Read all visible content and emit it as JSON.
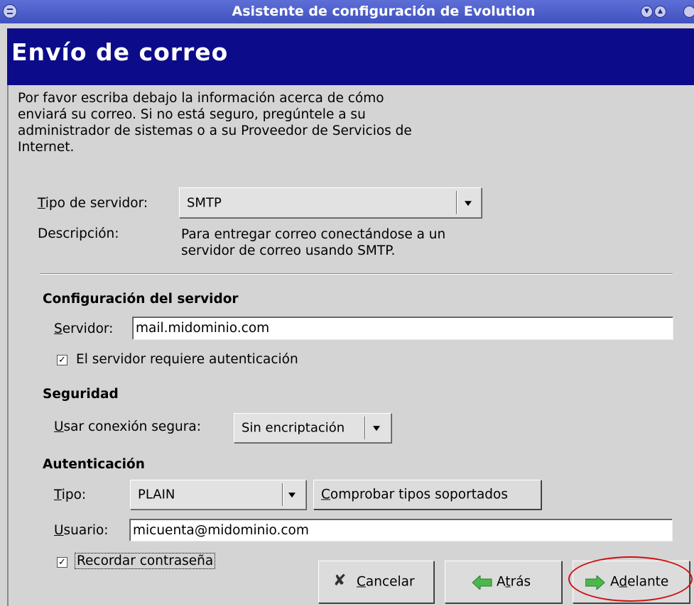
{
  "window": {
    "title": "Asistente de configuración de Evolution"
  },
  "header": {
    "title": "Envío de correo"
  },
  "intro": "Por favor escriba debajo la información acerca de cómo enviará su correo. Si no está seguro, pregúntele a su administrador de sistemas o a su Proveedor de Servicios de Internet.",
  "server_type": {
    "label": "Tipo de servidor:",
    "value": "SMTP",
    "description_label": "Descripción:",
    "description": "Para entregar correo conectándose a un servidor de correo usando SMTP."
  },
  "server_config": {
    "title": "Configuración del servidor",
    "server_label": "Servidor:",
    "server_value": "mail.midominio.com",
    "requires_auth_label": "El servidor requiere autenticación",
    "requires_auth_checked": true
  },
  "security": {
    "title": "Seguridad",
    "secure_label": "Usar conexión segura:",
    "secure_value": "Sin encriptación"
  },
  "auth": {
    "title": "Autenticación",
    "type_label": "Tipo:",
    "type_value": "PLAIN",
    "check_types_button": "Comprobar tipos soportados",
    "user_label": "Usuario:",
    "user_value": "micuenta@midominio.com",
    "remember_label": "Recordar contraseña",
    "remember_checked": true
  },
  "buttons": {
    "cancel": "Cancelar",
    "back": "Atrás",
    "forward": "Adelante"
  },
  "colors": {
    "title_bar": "#4a5bc8",
    "header_band": "#0c0c8a",
    "window_bg": "#d4d4d4",
    "highlight_circle": "#d01010",
    "arrow_icon": "#4cb84c"
  },
  "icons": [
    "window-menu-icon",
    "minimize-icon",
    "maximize-icon",
    "close-icon",
    "cancel-x-icon",
    "back-arrow-icon",
    "forward-arrow-icon",
    "dropdown-arrow-icon",
    "checkmark-icon"
  ]
}
